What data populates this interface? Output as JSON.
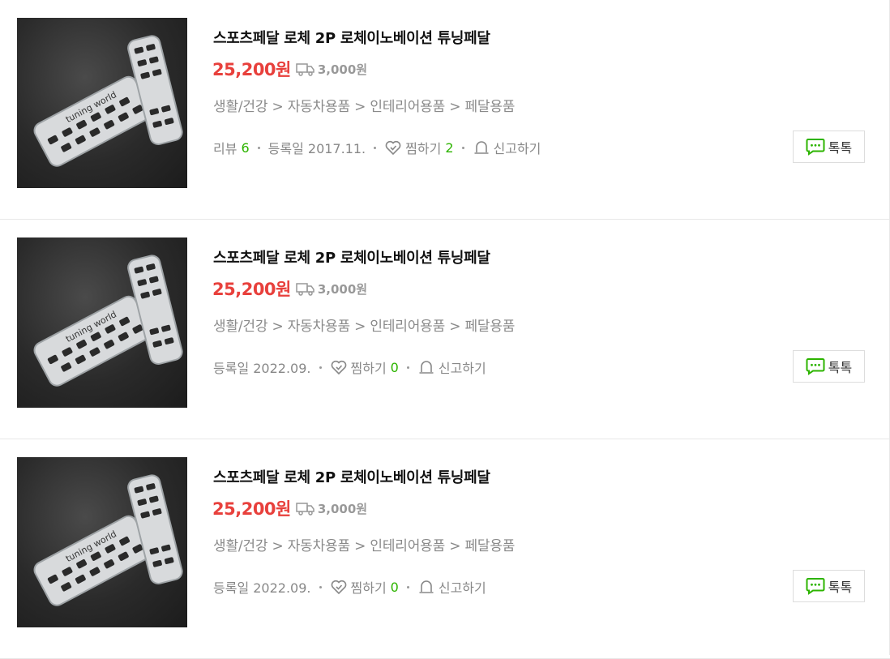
{
  "colors": {
    "price": "#e8403c",
    "count": "#2db400",
    "talk_icon": "#2db400"
  },
  "items": [
    {
      "image_alt": "tuning world pedal",
      "image_text": "tuning world",
      "title": "스포츠페달 로체 2P 로체이노베이션 튜닝페달",
      "price": "25,200원",
      "shipping": "3,000원",
      "category": "생활/건강 > 자동차용품 > 인테리어용품 > 페달용품",
      "review_label": "리뷰",
      "review_count": "6",
      "date": "등록일 2017.11.",
      "wish_label": "찜하기",
      "wish_count": "2",
      "report_label": "신고하기",
      "talk_label": "톡톡"
    },
    {
      "image_alt": "tuning world pedal",
      "image_text": "tuning world",
      "title": "스포츠페달 로체 2P 로체이노베이션 튜닝페달",
      "price": "25,200원",
      "shipping": "3,000원",
      "category": "생활/건강 > 자동차용품 > 인테리어용품 > 페달용품",
      "date": "등록일 2022.09.",
      "wish_label": "찜하기",
      "wish_count": "0",
      "report_label": "신고하기",
      "talk_label": "톡톡"
    },
    {
      "image_alt": "tuning world pedal",
      "image_text": "tuning world",
      "title": "스포츠페달 로체 2P 로체이노베이션 튜닝페달",
      "price": "25,200원",
      "shipping": "3,000원",
      "category": "생활/건강 > 자동차용품 > 인테리어용품 > 페달용품",
      "date": "등록일 2022.09.",
      "wish_label": "찜하기",
      "wish_count": "0",
      "report_label": "신고하기",
      "talk_label": "톡톡"
    }
  ]
}
